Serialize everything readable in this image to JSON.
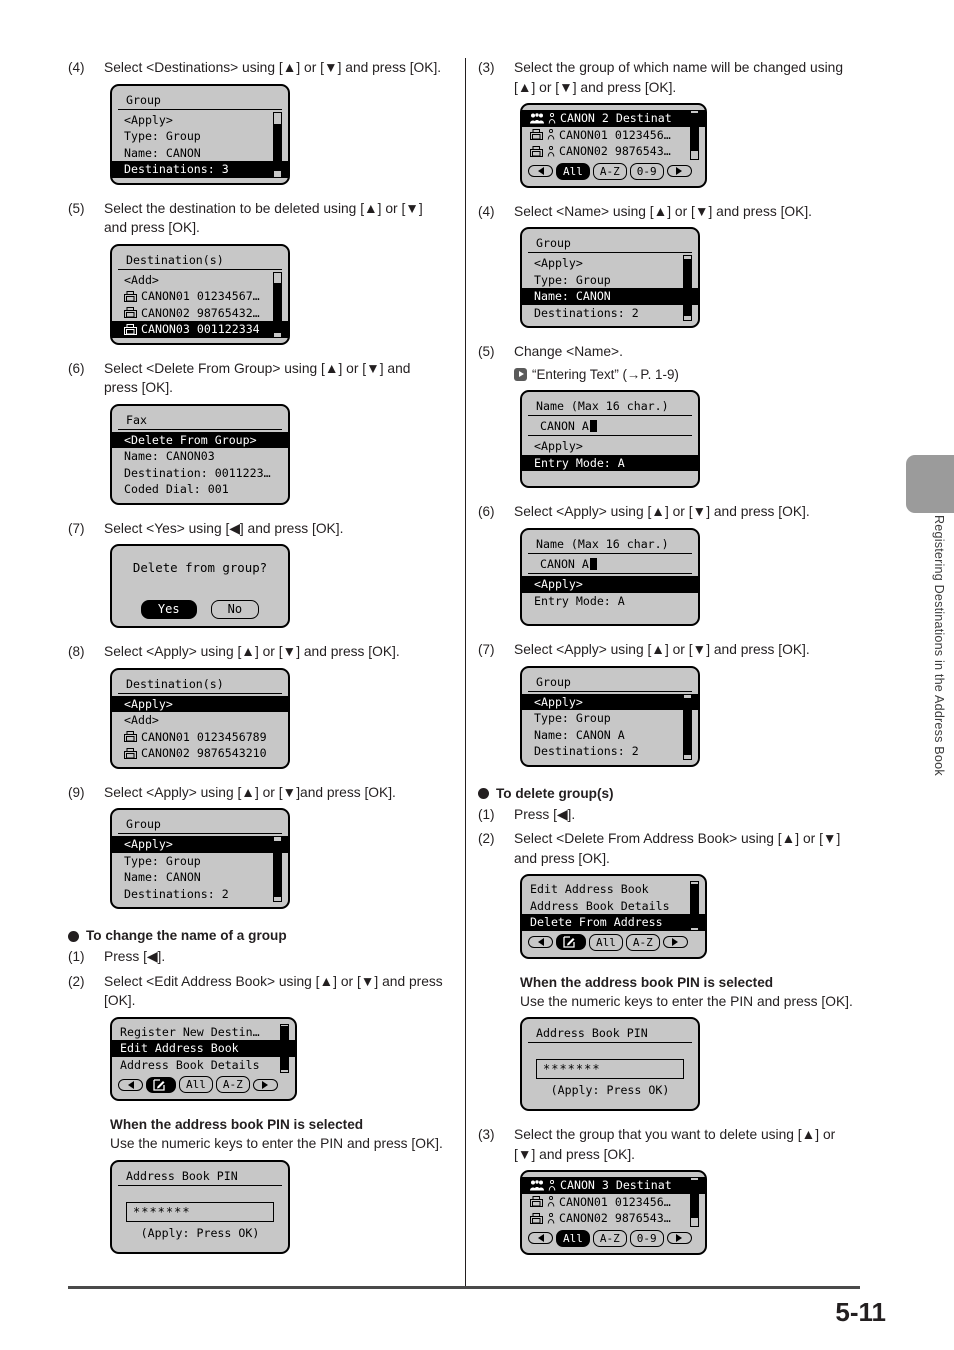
{
  "page": {
    "number": "5-11",
    "side_tab_label": "Registering Destinations in the Address Book"
  },
  "left_column": {
    "steps": [
      {
        "num": "(4)",
        "text": "Select <Destinations> using [▲] or [▼] and press [OK].",
        "screen": {
          "kind": "menu",
          "title": "Group",
          "rows": [
            {
              "text": "<Apply>",
              "highlight": false,
              "indent": true
            },
            {
              "text": "Type: Group",
              "highlight": false,
              "indent": true
            },
            {
              "text": "Name: CANON",
              "highlight": false,
              "indent": true
            },
            {
              "text": "Destinations: 3",
              "highlight": true,
              "indent": true
            }
          ],
          "scrollbar": {
            "visible": true,
            "top_pct": 18,
            "height_pct": 74
          }
        }
      },
      {
        "num": "(5)",
        "text": "Select the destination to be deleted using [▲] or [▼] and press [OK].",
        "screen": {
          "kind": "menu",
          "title": "Destination(s)",
          "rows": [
            {
              "text": "<Add>",
              "highlight": false,
              "indent": true
            },
            {
              "text": "CANON01 01234567…",
              "highlight": false,
              "indent": true,
              "icon": "fax-icon"
            },
            {
              "text": "CANON02 98765432…",
              "highlight": false,
              "indent": true,
              "icon": "fax-icon"
            },
            {
              "text": "CANON03 001122334",
              "highlight": true,
              "indent": true,
              "icon": "fax-icon"
            }
          ],
          "scrollbar": {
            "visible": true,
            "top_pct": 16,
            "height_pct": 78
          }
        }
      },
      {
        "num": "(6)",
        "text": "Select <Delete From Group> using [▲] or [▼] and press [OK].",
        "screen": {
          "kind": "menu",
          "title": "Fax",
          "rows": [
            {
              "text": "<Delete From Group>",
              "highlight": true,
              "indent": true
            },
            {
              "text": "Name: CANON03",
              "highlight": false,
              "indent": true
            },
            {
              "text": "Destination: 0011223…",
              "highlight": false,
              "indent": true
            },
            {
              "text": "Coded Dial: 001",
              "highlight": false,
              "indent": true
            }
          ],
          "scrollbar": {
            "visible": false
          }
        }
      },
      {
        "num": "(7)",
        "text": "Select <Yes> using [◀] and press [OK].",
        "screen": {
          "kind": "dialog",
          "message": "Delete from group?",
          "buttons": [
            {
              "label": "Yes",
              "selected": true
            },
            {
              "label": "No",
              "selected": false
            }
          ]
        }
      },
      {
        "num": "(8)",
        "text": "Select <Apply> using [▲] or [▼] and press [OK].",
        "screen": {
          "kind": "menu",
          "title": "Destination(s)",
          "rows": [
            {
              "text": "<Apply>",
              "highlight": true,
              "indent": true
            },
            {
              "text": "<Add>",
              "highlight": false,
              "indent": true
            },
            {
              "text": "CANON01 0123456789",
              "highlight": false,
              "indent": true,
              "icon": "fax-icon"
            },
            {
              "text": "CANON02 9876543210",
              "highlight": false,
              "indent": true,
              "icon": "fax-icon"
            }
          ],
          "scrollbar": {
            "visible": false
          }
        }
      },
      {
        "num": "(9)",
        "text": "Select <Apply> using [▲] or [▼]and press [OK].",
        "screen": {
          "kind": "menu",
          "title": "Group",
          "rows": [
            {
              "text": "<Apply>",
              "highlight": true,
              "indent": true
            },
            {
              "text": "Type: Group",
              "highlight": false,
              "indent": true
            },
            {
              "text": "Name: CANON",
              "highlight": false,
              "indent": true
            },
            {
              "text": "Destinations: 2",
              "highlight": false,
              "indent": true
            }
          ],
          "scrollbar": {
            "visible": true,
            "top_pct": 6,
            "height_pct": 88
          }
        }
      }
    ],
    "section": {
      "heading": "To change the name of a group",
      "steps": [
        {
          "num": "(1)",
          "text": "Press [◀]."
        },
        {
          "num": "(2)",
          "text": "Select <Edit Address Book> using [▲] or [▼] and press [OK].",
          "screen": {
            "kind": "menu-softkeys",
            "rows": [
              {
                "text": "Register New Destin…",
                "highlight": false
              },
              {
                "text": "Edit Address Book",
                "highlight": true
              },
              {
                "text": "Address Book Details",
                "highlight": false
              }
            ],
            "scrollbar": {
              "visible": true,
              "top_pct": 4,
              "height_pct": 92
            },
            "softkeys": [
              {
                "label": "",
                "kind": "left-arrow",
                "selected": false
              },
              {
                "label": "",
                "kind": "edit-icon",
                "selected": true
              },
              {
                "label": "All",
                "kind": "text",
                "selected": false
              },
              {
                "label": "A-Z",
                "kind": "text",
                "selected": false
              },
              {
                "label": "",
                "kind": "right-arrow",
                "selected": false
              }
            ]
          }
        }
      ],
      "pin_note_title": "When the address book PIN is selected",
      "pin_note_text": "Use the numeric keys to enter the PIN and press [OK].",
      "pin_screen": {
        "kind": "pin",
        "title": "Address Book PIN",
        "value": "*******",
        "hint": "(Apply: Press OK)"
      }
    }
  },
  "right_column": {
    "steps": [
      {
        "num": "(3)",
        "text": "Select the group of which name will be changed using [▲] or [▼] and press [OK].",
        "screen": {
          "kind": "addressbook",
          "rows": [
            {
              "text": "CANON 2 Destinat",
              "highlight": true,
              "icon": "group-icon",
              "icon2": "person-icon"
            },
            {
              "text": "CANON01 0123456…",
              "highlight": false,
              "icon": "fax-icon",
              "icon2": "person-icon"
            },
            {
              "text": "CANON02 9876543…",
              "highlight": false,
              "icon": "fax-icon",
              "icon2": "person-icon"
            }
          ],
          "scrollbar": {
            "visible": true,
            "top_pct": 4,
            "height_pct": 80
          },
          "softkeys": [
            {
              "label": "",
              "kind": "left-arrow",
              "selected": false
            },
            {
              "label": "All",
              "kind": "text",
              "selected": true
            },
            {
              "label": "A-Z",
              "kind": "text",
              "selected": false
            },
            {
              "label": "0-9",
              "kind": "text",
              "selected": false
            },
            {
              "label": "",
              "kind": "right-arrow",
              "selected": false
            }
          ]
        }
      },
      {
        "num": "(4)",
        "text": "Select <Name> using [▲] or [▼] and press [OK].",
        "screen": {
          "kind": "menu",
          "title": "Group",
          "rows": [
            {
              "text": "<Apply>",
              "highlight": false,
              "indent": true
            },
            {
              "text": "Type: Group",
              "highlight": false,
              "indent": true
            },
            {
              "text": "Name: CANON",
              "highlight": true,
              "indent": true
            },
            {
              "text": "Destinations: 2",
              "highlight": false,
              "indent": true
            }
          ],
          "scrollbar": {
            "visible": true,
            "top_pct": 4,
            "height_pct": 90
          }
        }
      },
      {
        "num": "(5)",
        "text": "Change <Name>.",
        "reference": "“Entering Text” (→P. 1-9)",
        "screen": {
          "kind": "textentry",
          "title": "Name (Max 16 char.)",
          "value": "CANON A",
          "rows": [
            {
              "text": "<Apply>",
              "highlight": false,
              "indent": true
            },
            {
              "text": "Entry Mode: A",
              "highlight": true,
              "indent": true
            }
          ]
        }
      },
      {
        "num": "(6)",
        "text": "Select <Apply> using [▲] or [▼] and press [OK].",
        "screen": {
          "kind": "textentry",
          "title": "Name (Max 16 char.)",
          "value": "CANON A",
          "value_underline": false,
          "rows": [
            {
              "text": "<Apply>",
              "highlight": true,
              "indent": true
            },
            {
              "text": "Entry Mode: A",
              "highlight": false,
              "indent": true
            }
          ]
        }
      },
      {
        "num": "(7)",
        "text": "Select <Apply> using [▲] or [▼] and press [OK].",
        "screen": {
          "kind": "menu",
          "title": "Group",
          "rows": [
            {
              "text": "<Apply>",
              "highlight": true,
              "indent": true
            },
            {
              "text": "Type: Group",
              "highlight": false,
              "indent": true
            },
            {
              "text": "Name: CANON A",
              "highlight": false,
              "indent": true
            },
            {
              "text": "Destinations: 2",
              "highlight": false,
              "indent": true
            }
          ],
          "scrollbar": {
            "visible": true,
            "top_pct": 6,
            "height_pct": 88
          }
        }
      }
    ],
    "section": {
      "heading": "To delete group(s)",
      "steps": [
        {
          "num": "(1)",
          "text": "Press [◀]."
        },
        {
          "num": "(2)",
          "text": "Select <Delete From Address Book> using [▲] or [▼] and press [OK].",
          "screen": {
            "kind": "menu-softkeys",
            "rows": [
              {
                "text": "Edit Address Book",
                "highlight": false
              },
              {
                "text": "Address Book Details",
                "highlight": false
              },
              {
                "text": "Delete From Address",
                "highlight": true
              }
            ],
            "scrollbar": {
              "visible": true,
              "top_pct": 4,
              "height_pct": 92
            },
            "softkeys": [
              {
                "label": "",
                "kind": "left-arrow",
                "selected": false
              },
              {
                "label": "",
                "kind": "edit-icon",
                "selected": true
              },
              {
                "label": "All",
                "kind": "text",
                "selected": false
              },
              {
                "label": "A-Z",
                "kind": "text",
                "selected": false
              },
              {
                "label": "",
                "kind": "right-arrow",
                "selected": false
              }
            ]
          }
        }
      ],
      "pin_note_title": "When the address book PIN is selected",
      "pin_note_text": "Use the numeric keys to enter the PIN and press [OK].",
      "pin_screen": {
        "kind": "pin",
        "title": "Address Book PIN",
        "value": "*******",
        "hint": "(Apply: Press OK)"
      },
      "final_step": {
        "num": "(3)",
        "text": "Select the group that you want to delete using [▲] or [▼] and press [OK].",
        "screen": {
          "kind": "addressbook",
          "rows": [
            {
              "text": "CANON 3 Destinat",
              "highlight": true,
              "icon": "group-icon",
              "icon2": "person-icon"
            },
            {
              "text": "CANON01 0123456…",
              "highlight": false,
              "icon": "fax-icon",
              "icon2": "person-icon"
            },
            {
              "text": "CANON02 9876543…",
              "highlight": false,
              "icon": "fax-icon",
              "icon2": "person-icon"
            }
          ],
          "scrollbar": {
            "visible": true,
            "top_pct": 4,
            "height_pct": 80
          },
          "softkeys": [
            {
              "label": "",
              "kind": "left-arrow",
              "selected": false
            },
            {
              "label": "All",
              "kind": "text",
              "selected": true
            },
            {
              "label": "A-Z",
              "kind": "text",
              "selected": false
            },
            {
              "label": "0-9",
              "kind": "text",
              "selected": false
            },
            {
              "label": "",
              "kind": "right-arrow",
              "selected": false
            }
          ]
        }
      }
    }
  }
}
